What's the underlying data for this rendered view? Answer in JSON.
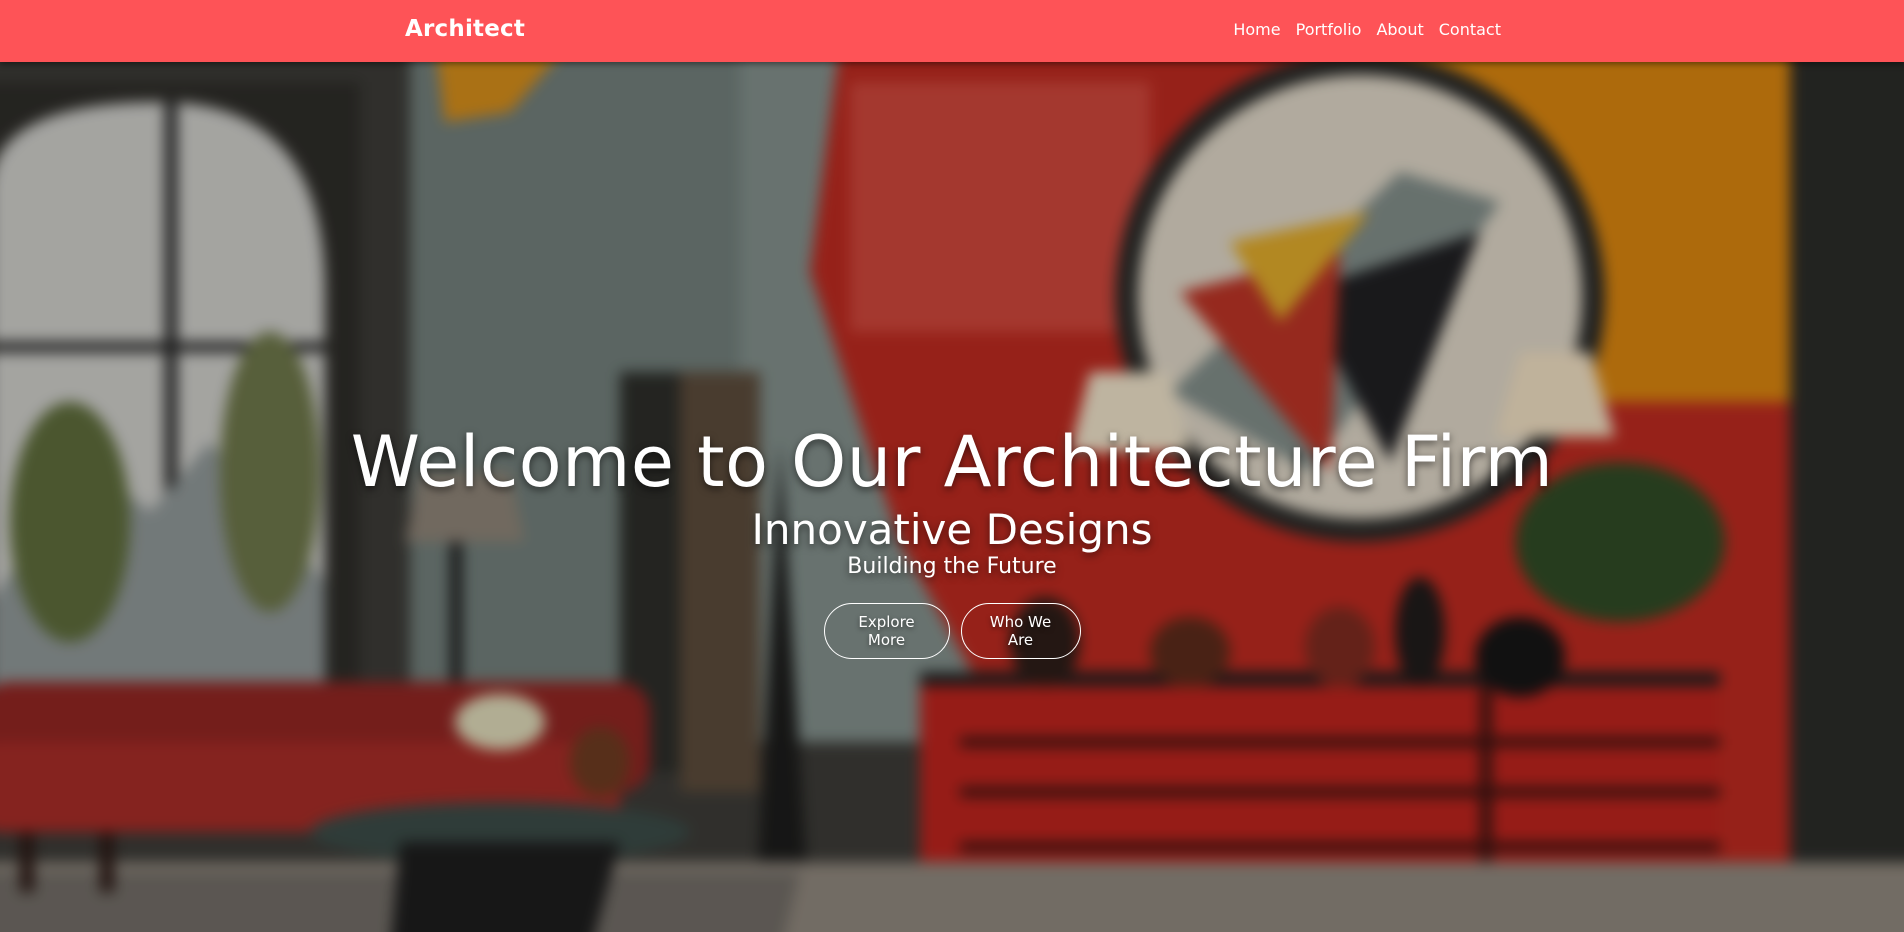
{
  "navbar": {
    "brand": "Architect",
    "links": [
      {
        "label": "Home"
      },
      {
        "label": "Portfolio"
      },
      {
        "label": "About"
      },
      {
        "label": "Contact"
      }
    ],
    "background_color": "#fe5357"
  },
  "hero": {
    "title": "Welcome to Our Architecture Firm",
    "subtitle": "Innovative Designs",
    "tagline": "Building the Future",
    "buttons": [
      {
        "label": "Explore More"
      },
      {
        "label": "Who We Are"
      }
    ],
    "background_image": "blurred-modern-living-room"
  }
}
